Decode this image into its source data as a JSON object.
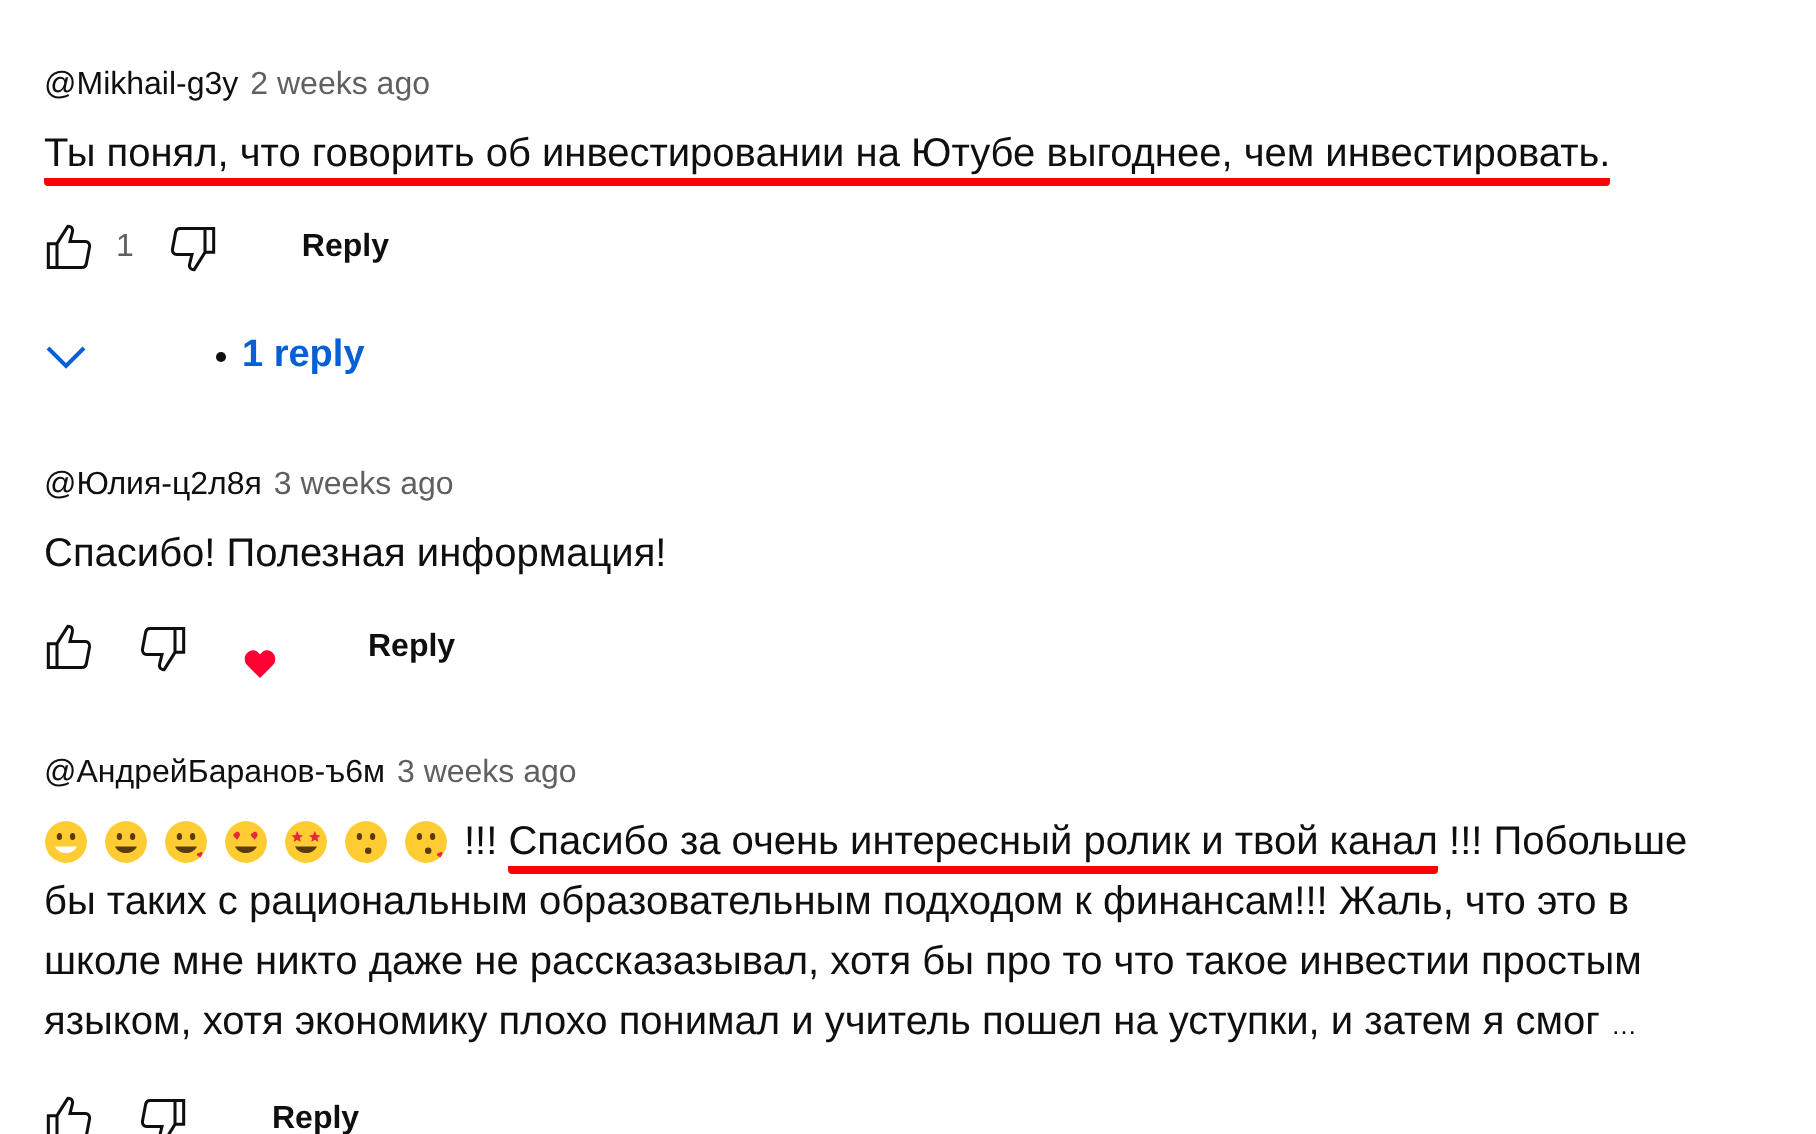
{
  "comments": [
    {
      "author": "@Mikhail-g3y",
      "time": "2 weeks ago",
      "emojis": false,
      "lines": [
        [
          {
            "text": "Ты понял, что говорить об инвестировании на Ютубе выгоднее, чем инвестировать.",
            "underlined": true
          }
        ]
      ],
      "likes": "1",
      "hearted": false,
      "reply_label": "Reply",
      "replies": "1 reply",
      "expanded": false
    },
    {
      "author": "@Юлия-ц2л8я",
      "time": "3 weeks ago",
      "emojis": false,
      "lines": [
        [
          {
            "text": "Спасибо! Полезная информация!",
            "underlined": false
          }
        ]
      ],
      "hearted": true,
      "reply_label": "Reply"
    },
    {
      "author": "@АндрейБаранов-ъ6м",
      "time": "3 weeks ago",
      "emojis": true,
      "lines": [
        [
          {
            "text": "!!! ",
            "underlined": false
          },
          {
            "text": "Спасибо за очень интересный ролик и твой канал",
            "underlined": true
          },
          {
            "text": " !!! Побольше",
            "underlined": false
          }
        ],
        [
          {
            "text": "бы таких с рациональным образовательным подходом к финансам!!! Жаль, что это в",
            "underlined": false
          }
        ],
        [
          {
            "text": "школе мне никто даже не рассказазывал, хотя бы про то что такое инвестии простым",
            "underlined": false
          }
        ],
        [
          {
            "text": "языком, хотя экономику плохо понимал и учитель пошел на уступки, и затем я смог ",
            "underlined": false
          },
          {
            "text": "…",
            "underlined": false
          }
        ]
      ],
      "hearted": false,
      "reply_label": "Reply"
    }
  ]
}
